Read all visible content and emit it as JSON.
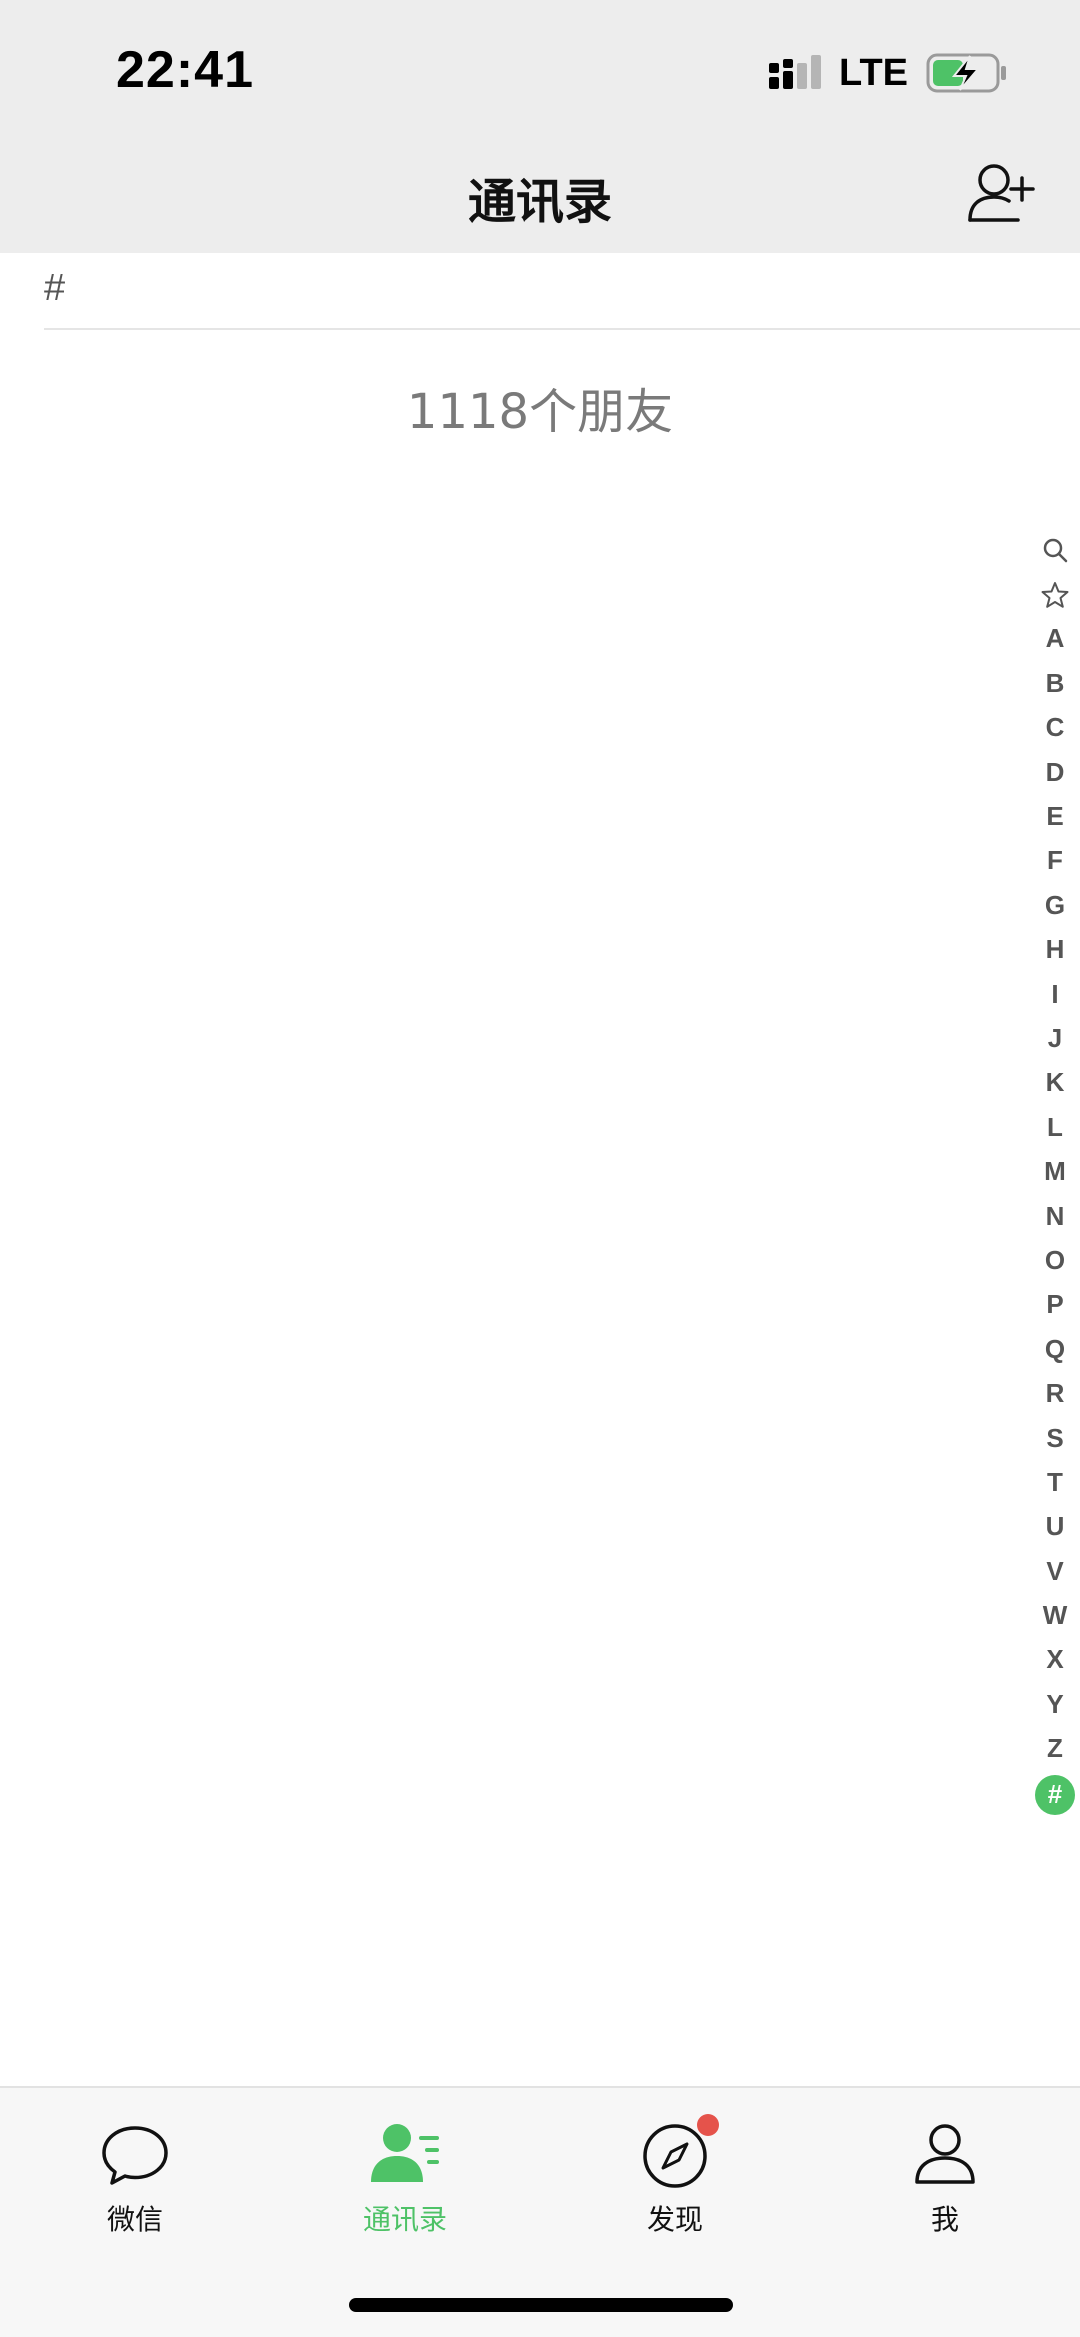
{
  "status_bar": {
    "time": "22:41",
    "network": "LTE",
    "icons": [
      "signal-icon",
      "battery-charging-icon"
    ]
  },
  "nav": {
    "title": "通讯录",
    "right_icon": "add-contact-icon"
  },
  "section": {
    "letter": "#"
  },
  "friend_count": "1118个朋友",
  "index_bar": {
    "top_icons": [
      "search-icon",
      "star-icon"
    ],
    "letters": [
      "A",
      "B",
      "C",
      "D",
      "E",
      "F",
      "G",
      "H",
      "I",
      "J",
      "K",
      "L",
      "M",
      "N",
      "O",
      "P",
      "Q",
      "R",
      "S",
      "T",
      "U",
      "V",
      "W",
      "X",
      "Y",
      "Z"
    ],
    "active": "#"
  },
  "tabs": [
    {
      "label": "微信",
      "icon": "chat-bubble-icon",
      "active": false
    },
    {
      "label": "通讯录",
      "icon": "contacts-icon",
      "active": true
    },
    {
      "label": "发现",
      "icon": "compass-icon",
      "active": false,
      "badge": true
    },
    {
      "label": "我",
      "icon": "person-icon",
      "active": false
    }
  ],
  "colors": {
    "accent": "#4ec267",
    "badge": "#e5534b",
    "bar_background": "#ededed"
  }
}
